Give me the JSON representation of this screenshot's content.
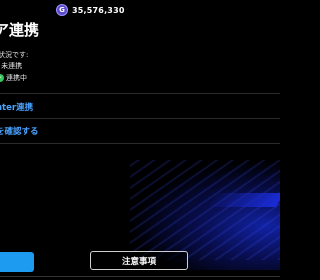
{
  "currency": {
    "icon": "gem-coin-icon",
    "icon_glyph": "G",
    "amount": "35,576,330"
  },
  "page": {
    "title": "ア連携",
    "status_caption": "状況です:",
    "statuses": [
      {
        "text": "r 未連携",
        "icon": null
      },
      {
        "text": "連携中",
        "icon": "check-icon"
      }
    ]
  },
  "menu": [
    {
      "label": "nter連携"
    },
    {
      "label": "を確認する"
    }
  ],
  "footer": {
    "notice_label": "注意事項"
  },
  "colors": {
    "link_blue": "#4aa3ff",
    "accent_blue": "#1d9bf0",
    "status_green": "#35c759",
    "background": "#000000"
  }
}
